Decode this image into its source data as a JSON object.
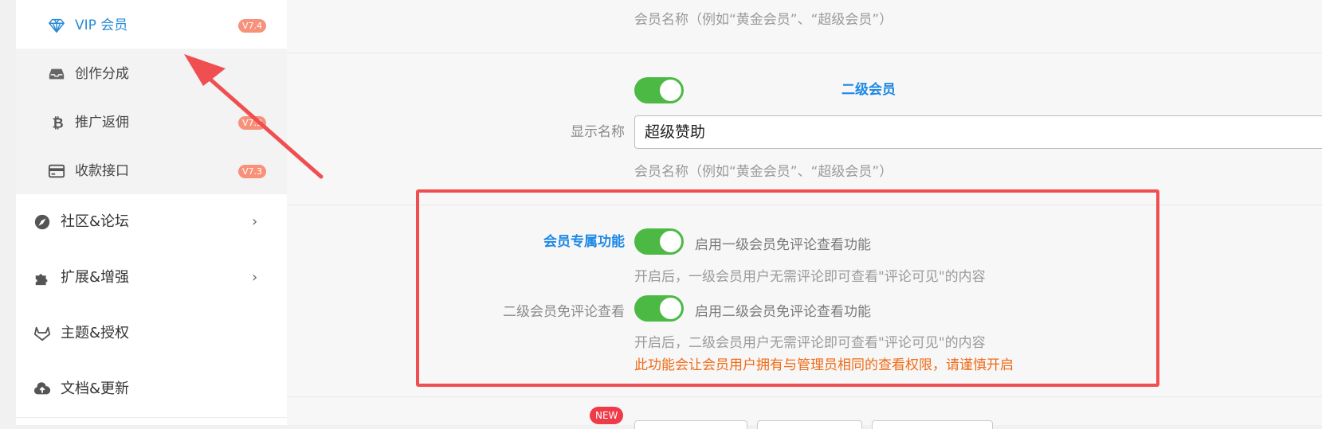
{
  "sidebar": {
    "sub_items": [
      {
        "label": "VIP 会员",
        "badge": "V7.4",
        "icon": "diamond-icon"
      },
      {
        "label": "创作分成",
        "badge": "",
        "icon": "inbox-tray-icon"
      },
      {
        "label": "推广返佣",
        "badge": "V7.3",
        "icon": "bitcoin-icon"
      },
      {
        "label": "收款接口",
        "badge": "V7.3",
        "icon": "credit-card-icon"
      }
    ],
    "top_items": [
      {
        "label": "社区&论坛",
        "icon": "compass-icon",
        "chevron": "›"
      },
      {
        "label": "扩展&增强",
        "icon": "puzzle-icon",
        "chevron": "›"
      },
      {
        "label": "主题&授权",
        "icon": "gitlab-fox-icon"
      },
      {
        "label": "文档&更新",
        "icon": "cloud-upload-icon"
      }
    ]
  },
  "main": {
    "top_hint": "会员名称（例如“黄金会员”、“超级会员”）",
    "level2": {
      "label": "二级会员",
      "display_name_label": "显示名称",
      "display_name_value": "超级赞助",
      "hint": "会员名称（例如“黄金会员”、“超级会员”）"
    },
    "exclusive": {
      "label": "会员专属功能",
      "toggle1_text": "启用一级会员免评论查看功能",
      "hint1": "开启后，一级会员用户无需评论即可查看\"评论可见\"的内容",
      "level2_label": "二级会员免评论查看",
      "toggle2_text": "启用二级会员免评论查看功能",
      "hint2": "开启后，二级会员用户无需评论即可查看\"评论可见\"的内容",
      "warning": "此功能会让会员用户拥有与管理员相同的查看权限，请谨慎开启"
    },
    "new_badge": "NEW"
  },
  "colors": {
    "accent_blue": "#1e88e5",
    "toggle_green": "#4cb944",
    "highlight_red": "#f04f52",
    "warning_orange": "#f06b16"
  }
}
